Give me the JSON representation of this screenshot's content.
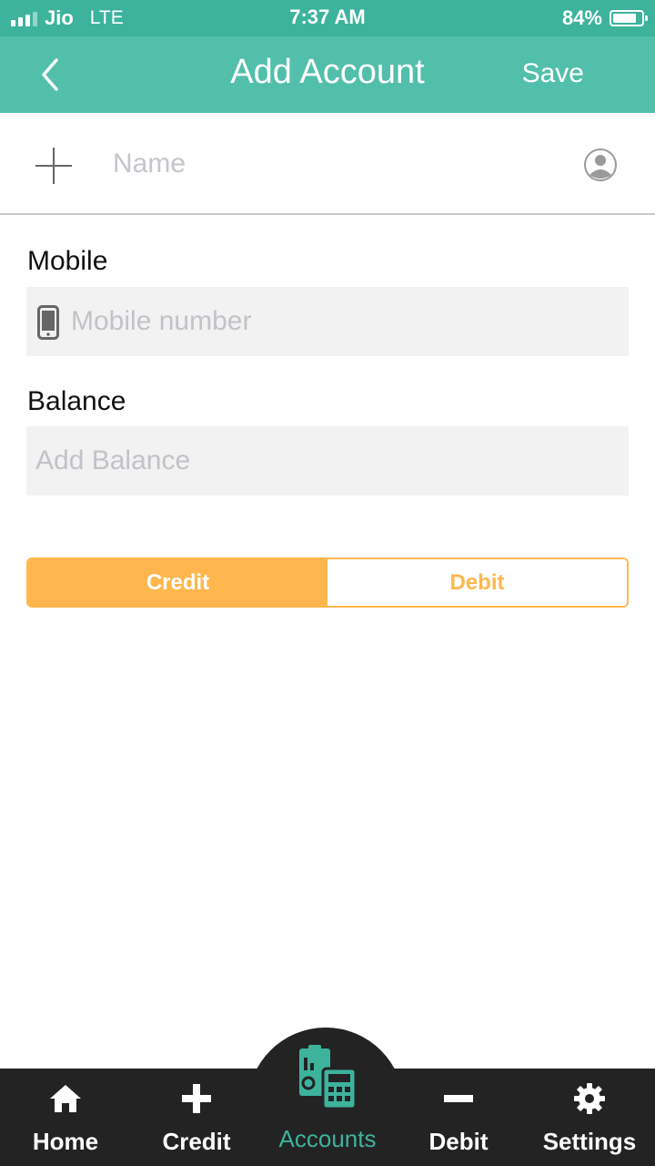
{
  "status_bar": {
    "carrier": "Jio",
    "network": "LTE",
    "time": "7:37 AM",
    "battery": "84%",
    "battery_level": 0.84
  },
  "header": {
    "title": "Add Account",
    "save_label": "Save",
    "back_icon": "chevron-left-icon"
  },
  "name_row": {
    "placeholder": "Name",
    "add_icon": "plus-icon",
    "contact_icon": "person-circle-icon"
  },
  "mobile": {
    "label": "Mobile",
    "placeholder": "Mobile number",
    "icon": "phone-icon"
  },
  "balance": {
    "label": "Balance",
    "placeholder": "Add Balance"
  },
  "type_toggle": {
    "options": [
      "Credit",
      "Debit"
    ],
    "selected": "Credit"
  },
  "tabs": [
    {
      "label": "Home",
      "icon": "home-icon"
    },
    {
      "label": "Credit",
      "icon": "plus-icon"
    },
    {
      "label": "Accounts",
      "icon": "accounts-calculator-icon",
      "active": true
    },
    {
      "label": "Debit",
      "icon": "minus-icon"
    },
    {
      "label": "Settings",
      "icon": "gear-icon"
    }
  ],
  "colors": {
    "accent": "#52bfaa",
    "statusbar": "#3db39c",
    "toggle": "#ffb74d",
    "tabbar": "#232323"
  }
}
